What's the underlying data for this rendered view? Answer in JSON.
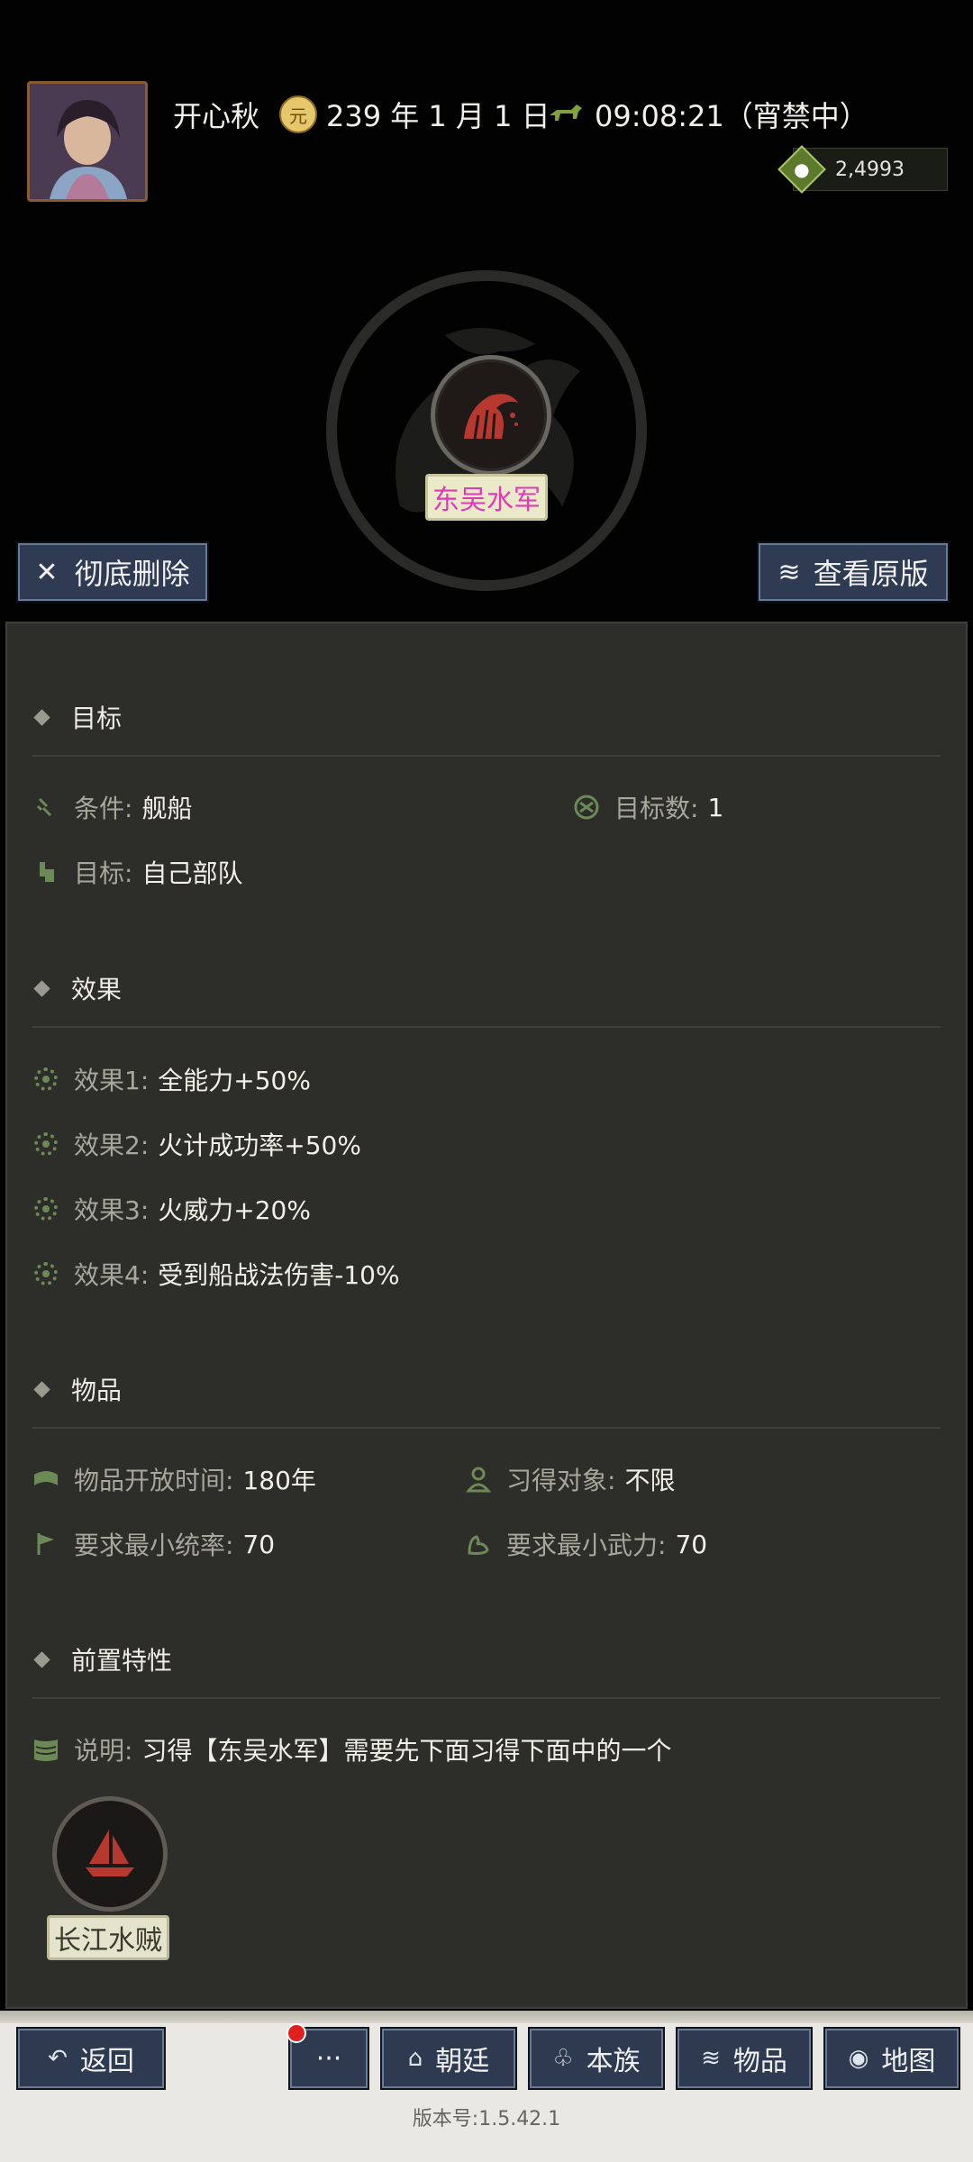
{
  "header": {
    "player_name": "开心秋",
    "date": "239 年 1 月 1 日",
    "time": "09:08:21（宵禁中）",
    "money": "2,4993",
    "date_icon": "coin-icon",
    "time_icon": "horse-icon",
    "money_icon": "money-bag-icon"
  },
  "skill": {
    "name": "东吴水军",
    "icon": "wave-icon"
  },
  "buttons": {
    "delete_label": "彻底删除",
    "view_original_label": "查看原版"
  },
  "sections": {
    "target": {
      "title": "目标",
      "condition_label": "条件:",
      "condition_value": "舰船",
      "target_count_label": "目标数:",
      "target_count_value": "1",
      "target_label": "目标:",
      "target_value": "自己部队"
    },
    "effects": {
      "title": "效果",
      "items": [
        {
          "label": "效果1:",
          "value": "全能力+50%"
        },
        {
          "label": "效果2:",
          "value": "火计成功率+50%"
        },
        {
          "label": "效果3:",
          "value": "火威力+20%"
        },
        {
          "label": "效果4:",
          "value": "受到船战法伤害-10%"
        }
      ]
    },
    "item": {
      "title": "物品",
      "open_time_label": "物品开放时间:",
      "open_time_value": "180年",
      "learner_label": "习得对象:",
      "learner_value": "不限",
      "min_command_label": "要求最小统率:",
      "min_command_value": "70",
      "min_force_label": "要求最小武力:",
      "min_force_value": "70"
    },
    "prereq": {
      "title": "前置特性",
      "desc_label": "说明:",
      "desc_value": "习得【东吴水军】需要先下面习得下面中的一个",
      "skills": [
        {
          "name": "长江水贼",
          "icon": "sailboat-icon"
        }
      ]
    }
  },
  "nav": {
    "back": "返回",
    "more": "···",
    "court": "朝廷",
    "clan": "本族",
    "items": "物品",
    "map": "地图"
  },
  "version": "版本号:1.5.42.1",
  "colors": {
    "skill_name": "#e03ab8",
    "accent_green": "#6c8a55",
    "button_bg": "#2e3a50"
  }
}
